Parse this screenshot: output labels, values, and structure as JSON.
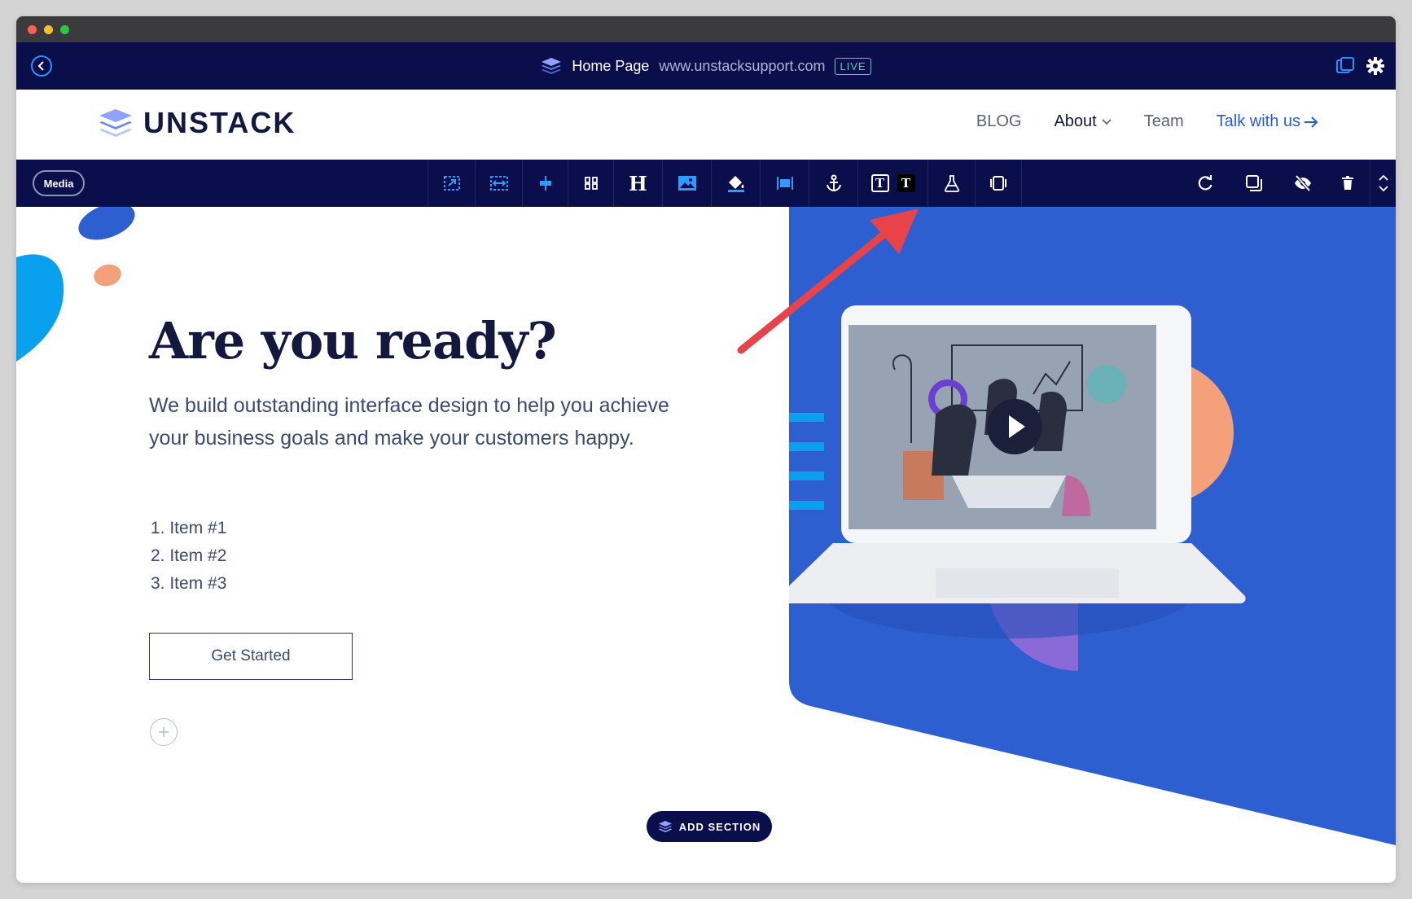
{
  "editor": {
    "page_name": "Home Page",
    "url": "www.unstacksupport.com",
    "status_badge": "LIVE"
  },
  "site": {
    "logo_text": "UNSTACK",
    "nav": {
      "blog": "BLOG",
      "about": "About",
      "team": "Team",
      "cta": "Talk with us"
    }
  },
  "toolbar": {
    "media_label": "Media",
    "text_t1": "T",
    "text_t2": "T",
    "heading_glyph": "H"
  },
  "hero": {
    "title": "Are you ready?",
    "lead": "We build outstanding interface design to help you achieve your business goals and make your customers happy.",
    "items": [
      "1. Item #1",
      "2. Item #2",
      "3. Item #3"
    ],
    "button": "Get Started"
  },
  "add_section": "ADD SECTION",
  "colors": {
    "navy": "#0a0e4a",
    "brand_blue": "#2d5fd0",
    "accent_orange": "#f4a07a",
    "accent_purple": "#8a6ad6",
    "arrow_red": "#e9434a"
  }
}
